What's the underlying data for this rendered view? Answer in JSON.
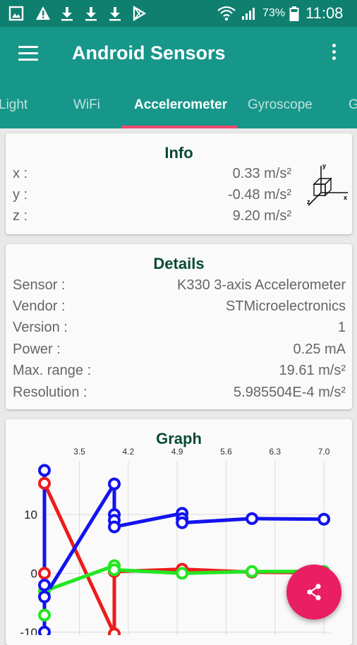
{
  "status_bar": {
    "battery_percent": "73%",
    "time": "11:08",
    "left_icons": [
      "gallery-icon",
      "warning-icon",
      "download-icon",
      "download-icon",
      "download-icon",
      "play-store-icon"
    ],
    "right_icons": [
      "wifi-icon",
      "signal-icon",
      "battery-icon"
    ]
  },
  "app_bar": {
    "title": "Android Sensors"
  },
  "tabs": [
    {
      "label": "Light",
      "active": false
    },
    {
      "label": "WiFi",
      "active": false
    },
    {
      "label": "Accelerometer",
      "active": true
    },
    {
      "label": "Gyroscope",
      "active": false
    },
    {
      "label": "G",
      "active": false
    }
  ],
  "info": {
    "title": "Info",
    "rows": [
      {
        "label": "x :",
        "value": "0.33 m/s²"
      },
      {
        "label": "y :",
        "value": "-0.48 m/s²"
      },
      {
        "label": "z :",
        "value": "9.20 m/s²"
      }
    ],
    "axes_icon": {
      "x": "x",
      "y": "y",
      "z": "z"
    }
  },
  "details": {
    "title": "Details",
    "rows": [
      {
        "label": "Sensor :",
        "value": "K330 3-axis Accelerometer"
      },
      {
        "label": "Vendor :",
        "value": "STMicroelectronics"
      },
      {
        "label": "Version :",
        "value": "1"
      },
      {
        "label": "Power :",
        "value": "0.25 mA"
      },
      {
        "label": "Max. range :",
        "value": "19.61 m/s²"
      },
      {
        "label": "Resolution :",
        "value": "5.985504E-4 m/s²"
      }
    ]
  },
  "graph": {
    "title": "Graph"
  },
  "chart_data": {
    "type": "line",
    "title": "Graph",
    "x_ticks": [
      "3.5",
      "4.2",
      "4.9",
      "5.6",
      "6.3",
      "7.0"
    ],
    "y_ticks": [
      "10",
      "0",
      "-10"
    ],
    "xlim": [
      2.98,
      7.1
    ],
    "ylim": [
      -10.5,
      19
    ],
    "grid": true,
    "series": [
      {
        "color": "#ee1c1c",
        "points": [
          [
            3.0,
            0
          ],
          [
            3.0,
            15.3
          ],
          [
            4.0,
            -10.3
          ],
          [
            4.0,
            0.3
          ],
          [
            4.97,
            0.7
          ],
          [
            5.97,
            0.2
          ],
          [
            7.0,
            0.1
          ]
        ]
      },
      {
        "color": "#22e622",
        "points": [
          [
            3.0,
            -7.1
          ],
          [
            3.0,
            -3.0
          ],
          [
            4.0,
            1.3
          ],
          [
            4.0,
            0.6
          ],
          [
            4.97,
            0
          ],
          [
            5.97,
            0.3
          ],
          [
            7.0,
            0.3
          ]
        ]
      },
      {
        "color": "#1313ee",
        "points": [
          [
            3.0,
            17.5
          ],
          [
            3.0,
            -10
          ],
          [
            3.0,
            -2.0
          ],
          [
            3.0,
            -4.0
          ],
          [
            4.0,
            15.2
          ],
          [
            4.0,
            10.0
          ],
          [
            4.0,
            9.0
          ],
          [
            4.0,
            7.9
          ],
          [
            4.97,
            10.2
          ],
          [
            4.97,
            9.3
          ],
          [
            4.97,
            8.6
          ],
          [
            5.97,
            9.3
          ],
          [
            7.0,
            9.2
          ]
        ]
      }
    ]
  },
  "fab": {
    "icon": "share-icon",
    "color": "#e91e63"
  }
}
